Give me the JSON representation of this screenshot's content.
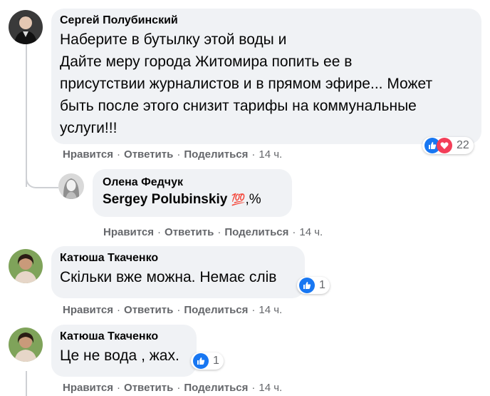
{
  "colors": {
    "bubble": "#f0f2f5",
    "meta_text": "#65676b",
    "like_blue": "#1877f2",
    "love_red": "#f33e58",
    "thread_line": "#ced0d4"
  },
  "comments": [
    {
      "author": "Сергей Полубинский",
      "lines": [
        "Наберите в бутылку этой воды и",
        "Дайте меру города Житомира попить ее в",
        "присутствии журналистов и в прямом эфире... Может",
        "быть после этого снизит тарифы на коммунальные",
        "услуги!!!"
      ],
      "reactions": {
        "icons": [
          "like-icon",
          "love-icon"
        ],
        "count": "22"
      },
      "actions": {
        "like": "Нравится",
        "reply": "Ответить",
        "share": "Поделиться",
        "time": "14 ч."
      }
    },
    {
      "author": "Олена Федчук",
      "mention": "Sergey Polubinskiy",
      "emoji": "💯",
      "suffix": ",%",
      "actions": {
        "like": "Нравится",
        "reply": "Ответить",
        "share": "Поделиться",
        "time": "14 ч."
      }
    },
    {
      "author": "Катюша Ткаченко",
      "text": "Скільки вже можна. Немає слів",
      "reactions": {
        "icons": [
          "like-icon"
        ],
        "count": "1"
      },
      "actions": {
        "like": "Нравится",
        "reply": "Ответить",
        "share": "Поделиться",
        "time": "14 ч."
      }
    },
    {
      "author": "Катюша Ткаченко",
      "text": "Це не вода , жах.",
      "reactions": {
        "icons": [
          "like-icon"
        ],
        "count": "1"
      },
      "actions": {
        "like": "Нравится",
        "reply": "Ответить",
        "share": "Поделиться",
        "time": "14 ч."
      }
    }
  ]
}
